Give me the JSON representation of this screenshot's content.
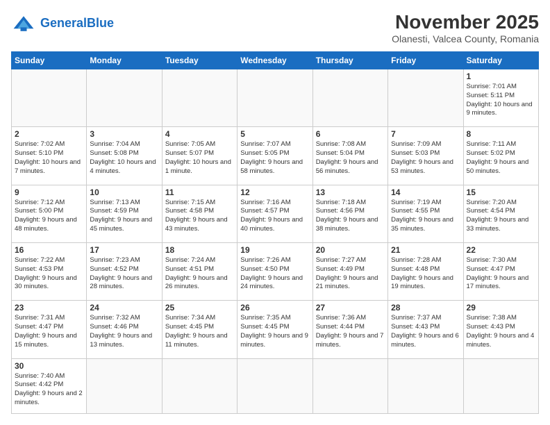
{
  "header": {
    "logo_general": "General",
    "logo_blue": "Blue",
    "month": "November 2025",
    "location": "Olanesti, Valcea County, Romania"
  },
  "weekdays": [
    "Sunday",
    "Monday",
    "Tuesday",
    "Wednesday",
    "Thursday",
    "Friday",
    "Saturday"
  ],
  "days": [
    {
      "num": "",
      "info": ""
    },
    {
      "num": "",
      "info": ""
    },
    {
      "num": "",
      "info": ""
    },
    {
      "num": "",
      "info": ""
    },
    {
      "num": "",
      "info": ""
    },
    {
      "num": "",
      "info": ""
    },
    {
      "num": "1",
      "info": "Sunrise: 7:01 AM\nSunset: 5:11 PM\nDaylight: 10 hours and 9 minutes."
    },
    {
      "num": "2",
      "info": "Sunrise: 7:02 AM\nSunset: 5:10 PM\nDaylight: 10 hours and 7 minutes."
    },
    {
      "num": "3",
      "info": "Sunrise: 7:04 AM\nSunset: 5:08 PM\nDaylight: 10 hours and 4 minutes."
    },
    {
      "num": "4",
      "info": "Sunrise: 7:05 AM\nSunset: 5:07 PM\nDaylight: 10 hours and 1 minute."
    },
    {
      "num": "5",
      "info": "Sunrise: 7:07 AM\nSunset: 5:05 PM\nDaylight: 9 hours and 58 minutes."
    },
    {
      "num": "6",
      "info": "Sunrise: 7:08 AM\nSunset: 5:04 PM\nDaylight: 9 hours and 56 minutes."
    },
    {
      "num": "7",
      "info": "Sunrise: 7:09 AM\nSunset: 5:03 PM\nDaylight: 9 hours and 53 minutes."
    },
    {
      "num": "8",
      "info": "Sunrise: 7:11 AM\nSunset: 5:02 PM\nDaylight: 9 hours and 50 minutes."
    },
    {
      "num": "9",
      "info": "Sunrise: 7:12 AM\nSunset: 5:00 PM\nDaylight: 9 hours and 48 minutes."
    },
    {
      "num": "10",
      "info": "Sunrise: 7:13 AM\nSunset: 4:59 PM\nDaylight: 9 hours and 45 minutes."
    },
    {
      "num": "11",
      "info": "Sunrise: 7:15 AM\nSunset: 4:58 PM\nDaylight: 9 hours and 43 minutes."
    },
    {
      "num": "12",
      "info": "Sunrise: 7:16 AM\nSunset: 4:57 PM\nDaylight: 9 hours and 40 minutes."
    },
    {
      "num": "13",
      "info": "Sunrise: 7:18 AM\nSunset: 4:56 PM\nDaylight: 9 hours and 38 minutes."
    },
    {
      "num": "14",
      "info": "Sunrise: 7:19 AM\nSunset: 4:55 PM\nDaylight: 9 hours and 35 minutes."
    },
    {
      "num": "15",
      "info": "Sunrise: 7:20 AM\nSunset: 4:54 PM\nDaylight: 9 hours and 33 minutes."
    },
    {
      "num": "16",
      "info": "Sunrise: 7:22 AM\nSunset: 4:53 PM\nDaylight: 9 hours and 30 minutes."
    },
    {
      "num": "17",
      "info": "Sunrise: 7:23 AM\nSunset: 4:52 PM\nDaylight: 9 hours and 28 minutes."
    },
    {
      "num": "18",
      "info": "Sunrise: 7:24 AM\nSunset: 4:51 PM\nDaylight: 9 hours and 26 minutes."
    },
    {
      "num": "19",
      "info": "Sunrise: 7:26 AM\nSunset: 4:50 PM\nDaylight: 9 hours and 24 minutes."
    },
    {
      "num": "20",
      "info": "Sunrise: 7:27 AM\nSunset: 4:49 PM\nDaylight: 9 hours and 21 minutes."
    },
    {
      "num": "21",
      "info": "Sunrise: 7:28 AM\nSunset: 4:48 PM\nDaylight: 9 hours and 19 minutes."
    },
    {
      "num": "22",
      "info": "Sunrise: 7:30 AM\nSunset: 4:47 PM\nDaylight: 9 hours and 17 minutes."
    },
    {
      "num": "23",
      "info": "Sunrise: 7:31 AM\nSunset: 4:47 PM\nDaylight: 9 hours and 15 minutes."
    },
    {
      "num": "24",
      "info": "Sunrise: 7:32 AM\nSunset: 4:46 PM\nDaylight: 9 hours and 13 minutes."
    },
    {
      "num": "25",
      "info": "Sunrise: 7:34 AM\nSunset: 4:45 PM\nDaylight: 9 hours and 11 minutes."
    },
    {
      "num": "26",
      "info": "Sunrise: 7:35 AM\nSunset: 4:45 PM\nDaylight: 9 hours and 9 minutes."
    },
    {
      "num": "27",
      "info": "Sunrise: 7:36 AM\nSunset: 4:44 PM\nDaylight: 9 hours and 7 minutes."
    },
    {
      "num": "28",
      "info": "Sunrise: 7:37 AM\nSunset: 4:43 PM\nDaylight: 9 hours and 6 minutes."
    },
    {
      "num": "29",
      "info": "Sunrise: 7:38 AM\nSunset: 4:43 PM\nDaylight: 9 hours and 4 minutes."
    },
    {
      "num": "30",
      "info": "Sunrise: 7:40 AM\nSunset: 4:42 PM\nDaylight: 9 hours and 2 minutes."
    },
    {
      "num": "",
      "info": ""
    },
    {
      "num": "",
      "info": ""
    },
    {
      "num": "",
      "info": ""
    },
    {
      "num": "",
      "info": ""
    },
    {
      "num": "",
      "info": ""
    }
  ]
}
